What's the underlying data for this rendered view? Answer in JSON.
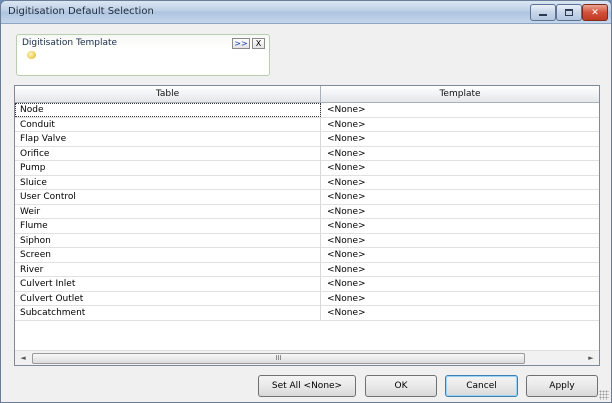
{
  "window": {
    "title": "Digitisation Default Selection",
    "controls": {
      "minimize": "minimize-icon",
      "maximize": "maximize-icon",
      "close": "close-icon"
    }
  },
  "template_panel": {
    "label": "Digitisation Template",
    "browse_label": ">>",
    "clear_label": "X",
    "icon": "template-icon"
  },
  "grid": {
    "columns": [
      "Table",
      "Template"
    ],
    "rows": [
      {
        "table": "Node",
        "template": "<None>"
      },
      {
        "table": "Conduit",
        "template": "<None>"
      },
      {
        "table": "Flap Valve",
        "template": "<None>"
      },
      {
        "table": "Orifice",
        "template": "<None>"
      },
      {
        "table": "Pump",
        "template": "<None>"
      },
      {
        "table": "Sluice",
        "template": "<None>"
      },
      {
        "table": "User Control",
        "template": "<None>"
      },
      {
        "table": "Weir",
        "template": "<None>"
      },
      {
        "table": "Flume",
        "template": "<None>"
      },
      {
        "table": "Siphon",
        "template": "<None>"
      },
      {
        "table": "Screen",
        "template": "<None>"
      },
      {
        "table": "River",
        "template": "<None>"
      },
      {
        "table": "Culvert Inlet",
        "template": "<None>"
      },
      {
        "table": "Culvert Outlet",
        "template": "<None>"
      },
      {
        "table": "Subcatchment",
        "template": "<None>"
      }
    ],
    "scrollbar": {
      "left": "◄",
      "right": "►",
      "thumb": "III"
    }
  },
  "buttons": {
    "set_all": "Set All <None>",
    "ok": "OK",
    "cancel": "Cancel",
    "apply": "Apply"
  }
}
